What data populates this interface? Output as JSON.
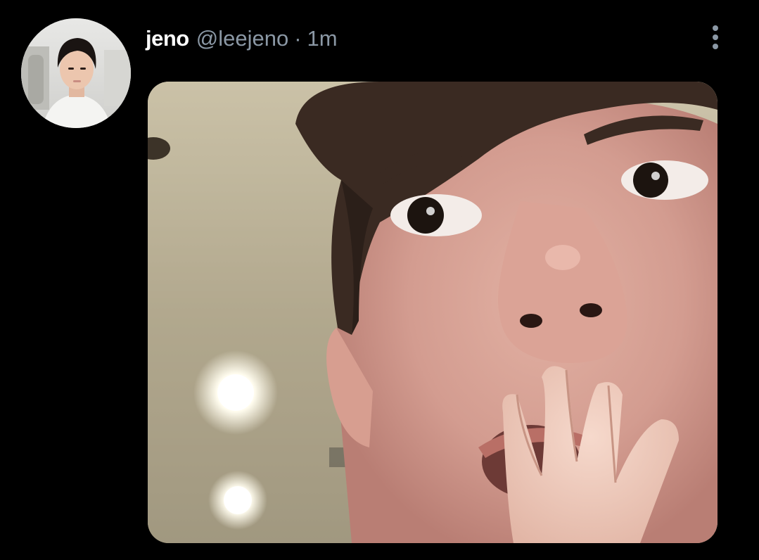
{
  "tweet": {
    "display_name": "jeno",
    "handle": "@leejeno",
    "separator": "·",
    "timestamp": "1m",
    "more_icon": "more-vertical-icon",
    "avatar_alt": "profile photo of jeno",
    "media_alt": "close-up selfie of a surprised young man covering his mouth with his hand, ceiling lights behind him"
  },
  "colors": {
    "background": "#000000",
    "name": "#ffffff",
    "secondary_text": "#8b98a5"
  }
}
